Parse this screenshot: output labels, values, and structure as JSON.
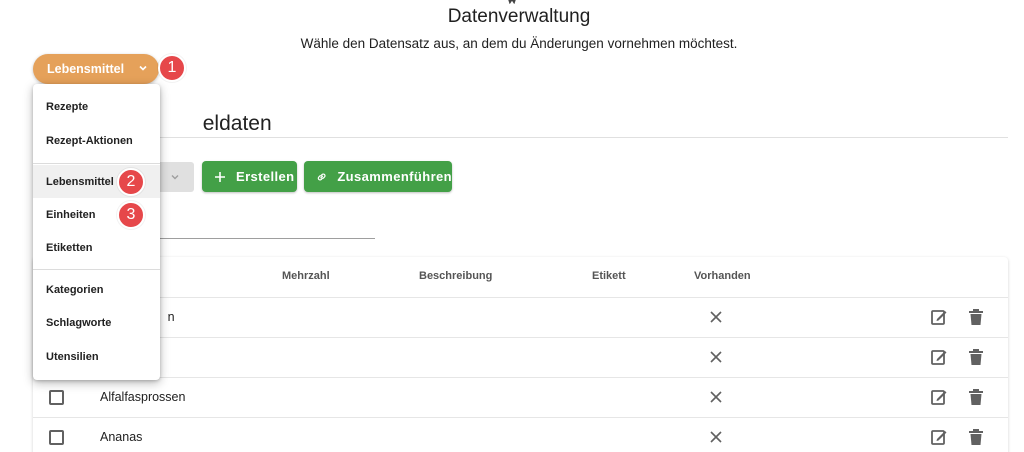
{
  "header": {
    "title": "Datenverwaltung",
    "subtitle": "Wähle den Datensatz aus, an dem du Änderungen vornehmen möchtest."
  },
  "dataset_selector": {
    "label": "Lebensmittel"
  },
  "callouts": [
    "1",
    "2",
    "3"
  ],
  "section": {
    "title_visible": "eldaten"
  },
  "toolbar": {
    "create_label": "Erstellen",
    "merge_label": "Zusammenführen"
  },
  "table": {
    "columns": [
      "Mehrzahl",
      "Beschreibung",
      "Etikett",
      "Vorhanden"
    ],
    "rows": [
      {
        "name": "n"
      },
      {
        "name": ""
      },
      {
        "name": "Alfalfasprossen"
      },
      {
        "name": "Ananas"
      }
    ]
  },
  "menu": {
    "items": [
      {
        "label": "Rezepte"
      },
      {
        "label": "Rezept-Aktionen"
      },
      {
        "label": "Lebensmittel"
      },
      {
        "label": "Einheiten"
      },
      {
        "label": "Etiketten"
      },
      {
        "label": "Kategorien"
      },
      {
        "label": "Schlagworte"
      },
      {
        "label": "Utensilien"
      }
    ]
  },
  "colors": {
    "accent_orange": "#e5a15a",
    "callout_red": "#e6474a",
    "action_green": "#43a047"
  },
  "icons": [
    "chevron-down-icon",
    "plus-icon",
    "link-icon",
    "close-icon",
    "edit-icon",
    "trash-icon",
    "checkbox-icon"
  ]
}
